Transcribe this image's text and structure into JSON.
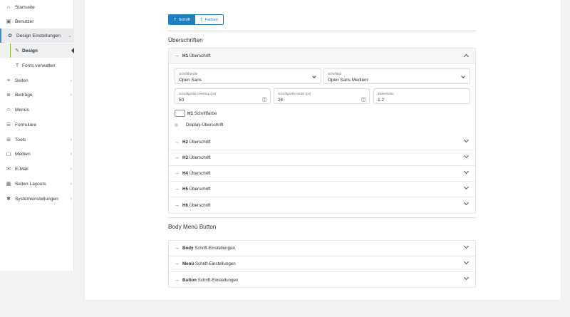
{
  "sidebar": {
    "items": [
      {
        "label": "Startseite",
        "icon": "home-icon",
        "glyph": "⌂",
        "chevron": false
      },
      {
        "label": "Benutzer",
        "icon": "user-card-icon",
        "glyph": "▣",
        "chevron": false
      },
      {
        "label": "Design Einstellungen",
        "icon": "palette-icon",
        "glyph": "✿",
        "chevron": true
      },
      {
        "label": "Design",
        "icon": "brush-icon",
        "glyph": "✎",
        "chevron": false
      },
      {
        "label": "Fonts verwalten",
        "icon": "font-icon",
        "glyph": "T",
        "chevron": false
      },
      {
        "label": "Seiten",
        "icon": "pages-icon",
        "glyph": "≡",
        "chevron": true
      },
      {
        "label": "Beiträge",
        "icon": "posts-icon",
        "glyph": "≣",
        "chevron": true
      },
      {
        "label": "Menüs",
        "icon": "menu-icon",
        "glyph": "⌓",
        "chevron": false
      },
      {
        "label": "Formulare",
        "icon": "form-icon",
        "glyph": "☰",
        "chevron": false
      },
      {
        "label": "Tools",
        "icon": "tools-icon",
        "glyph": "⊞",
        "chevron": true
      },
      {
        "label": "Medien",
        "icon": "media-icon",
        "glyph": "▢",
        "chevron": true
      },
      {
        "label": "E-Mail",
        "icon": "mail-icon",
        "glyph": "✉",
        "chevron": true
      },
      {
        "label": "Seiten Layouts",
        "icon": "layout-icon",
        "glyph": "▦",
        "chevron": true
      },
      {
        "label": "Systemeinstellungen",
        "icon": "gear-icon",
        "glyph": "✱",
        "chevron": true
      }
    ]
  },
  "tabs": [
    {
      "label": "Schrift",
      "icon": "T"
    },
    {
      "label": "Farben",
      "icon": "T"
    }
  ],
  "headings_section": {
    "title": "Überschriften",
    "h1": {
      "tag": "H1",
      "label": "Überschrift",
      "font_family_label": "Schriftfamilie",
      "font_family_value": "Open Sans",
      "font_style_label": "Schriftstil",
      "font_style_value": "Open Sans Medium",
      "size_desktop_label": "Schriftgröße Desktop (px)",
      "size_desktop_value": "50",
      "size_mobile_label": "Schriftgröße Mobil (px)",
      "size_mobile_value": "24",
      "line_height_label": "Zeilenhöhe",
      "line_height_value": "1.2",
      "color_tag": "H1",
      "color_label": "Schriftfarbe",
      "display_label": "Display-Überschrift"
    },
    "collapsed": [
      {
        "tag": "H2",
        "label": "Überschrift"
      },
      {
        "tag": "H3",
        "label": "Überschrift"
      },
      {
        "tag": "H4",
        "label": "Überschrift"
      },
      {
        "tag": "H5",
        "label": "Überschrift"
      },
      {
        "tag": "H6",
        "label": "Überschrift"
      }
    ]
  },
  "body_section": {
    "title": "Body Menü Button",
    "items": [
      {
        "tag": "Body",
        "label": "Schrift-Einstellungen"
      },
      {
        "tag": "Menü",
        "label": "Schrift-Einstellungen"
      },
      {
        "tag": "Button",
        "label": "Schrift-Einstellungen"
      }
    ]
  },
  "arrow_glyph": "→",
  "colors": {
    "accent": "#1f7fbf",
    "active_border": "#3a8ed0"
  }
}
